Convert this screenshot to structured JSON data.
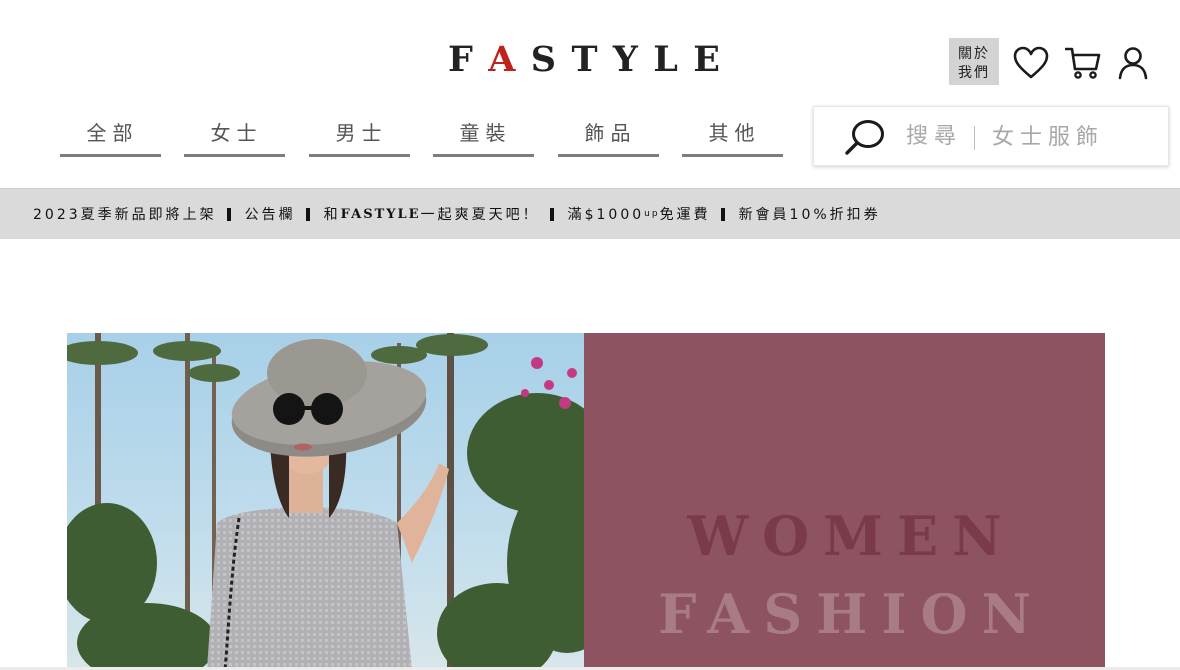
{
  "brand": {
    "logo_letters": [
      "F",
      "A",
      "S",
      "T",
      "Y",
      "L",
      "E"
    ],
    "accent_letter_index": 1,
    "accent_color": "#c0221b"
  },
  "header": {
    "about_label_line1": "關於",
    "about_label_line2": "我們",
    "icons": [
      "heart-icon",
      "cart-icon",
      "user-icon"
    ]
  },
  "nav": {
    "tabs": [
      {
        "label": "全部"
      },
      {
        "label": "女士"
      },
      {
        "label": "男士"
      },
      {
        "label": "童裝"
      },
      {
        "label": "飾品"
      },
      {
        "label": "其他"
      }
    ]
  },
  "search": {
    "label": "搜尋",
    "placeholder": "女士服飾",
    "value": ""
  },
  "announcement": {
    "item1": "2023夏季新品即將上架",
    "item2": "公告欄",
    "item3_prefix": "和",
    "item3_brand": "FASTYLE",
    "item3_suffix": "一起爽夏天吧！",
    "item4_prefix": "滿$1000",
    "item4_small": "up",
    "item4_suffix": "免運費",
    "item5": "新會員10%折扣券"
  },
  "hero": {
    "line1": "WOMEN",
    "line2": "FASHION",
    "panel_color": "#8d5361"
  }
}
